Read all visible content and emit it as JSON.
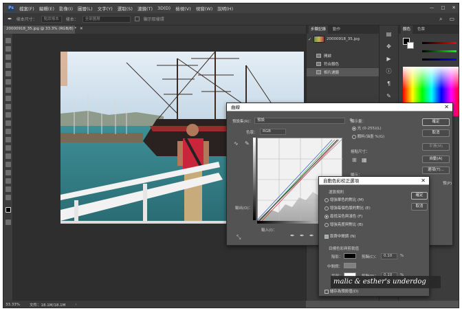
{
  "menubar": {
    "items": [
      "檔案(F)",
      "編輯(E)",
      "影像(I)",
      "圖層(L)",
      "文字(Y)",
      "選取(S)",
      "濾鏡(T)",
      "3D(D)",
      "檢視(V)",
      "視窗(W)",
      "說明(H)"
    ],
    "window_controls": [
      "—",
      "□",
      "✕"
    ]
  },
  "options_bar": {
    "sample_size_label": "樣本尺寸：",
    "sample_size_value": "點狀樣本",
    "sample_label": "樣本：",
    "sample_value": "全部圖層",
    "show_ring_label": "顯示取樣環"
  },
  "document_tab": {
    "label": "20000918_35.jpg @ 33.3% (RGB/8) *",
    "close": "✕"
  },
  "status_bar": {
    "zoom": "33.33%",
    "doc_size": "文件：18.1M/18.1M",
    "arrow": "›"
  },
  "history_panel": {
    "tabs": [
      "步驟記錄",
      "動作"
    ],
    "snapshot_label": "20000918_35.jpg",
    "steps": [
      "開啟",
      "符合顏色",
      "相片濾鏡"
    ]
  },
  "color_panel": {
    "tabs": [
      "顏色",
      "色票"
    ]
  },
  "curves_dialog": {
    "title": "曲線",
    "preset_label": "預設集(R)：",
    "preset_value": "預設",
    "channel_label": "色版：",
    "channel_value": "RGB",
    "output_label": "輸出(O)：",
    "input_label": "輸入(I)：",
    "display_amount_label": "顯示量：",
    "light_option": "光 (0-255)(L)",
    "pigment_option": "顏料/油墨 %(G)",
    "grid_size_label": "格點尺寸：",
    "display_label": "顯示：",
    "buttons": {
      "ok": "確定",
      "cancel": "取消",
      "smooth": "平滑(M)",
      "auto": "自動(A)",
      "options": "選項(T)...",
      "preview": "預(P)"
    }
  },
  "auto_color_dialog": {
    "title": "自動色彩校正選項",
    "algorithm_label": "運算規則",
    "algorithms": [
      "增強單色的對比 (M)",
      "增強每個色版的對比 (E)",
      "尋找深色與淺色 (F)",
      "增強亮度與對比 (B)"
    ],
    "selected_algorithm_index": 2,
    "snap_neutral_label": "靠齊中間調 (N)",
    "targets_label": "目標色彩與剪裁值",
    "shadows_label": "陰影：",
    "midtones_label": "中間調：",
    "highlights_label": "亮部：",
    "clip_label": "剪輯(C)：",
    "clip_label_h": "剪輯(P)：",
    "shadow_clip": "0.10",
    "highlight_clip": "0.10",
    "percent": "%",
    "save_default_label": "儲存為預設值(D)",
    "ok": "確定",
    "cancel": "取消",
    "close": "✕",
    "colors": {
      "shadow": "#000000",
      "midtone": "#808080",
      "highlight": "#ffffff"
    }
  },
  "watermark": {
    "text": "malic & esther's underdog"
  }
}
